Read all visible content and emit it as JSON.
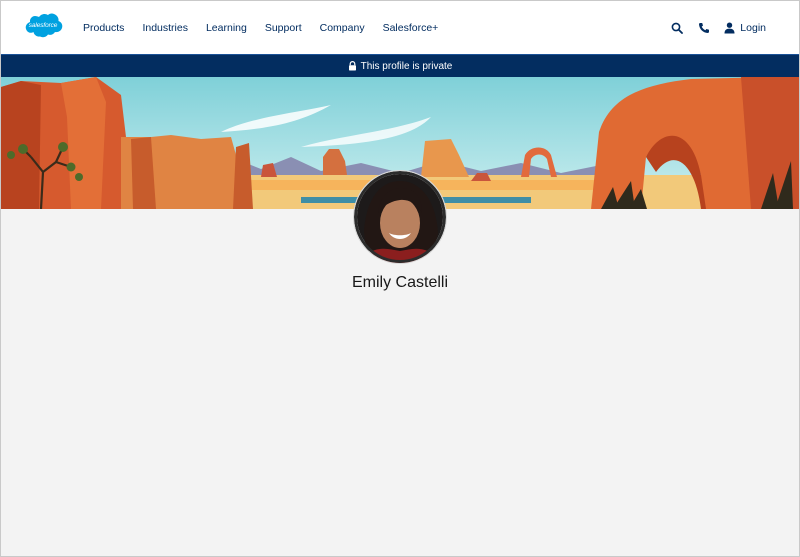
{
  "header": {
    "logo_text": "salesforce",
    "nav": [
      "Products",
      "Industries",
      "Learning",
      "Support",
      "Company",
      "Salesforce+"
    ],
    "login_label": "Login",
    "icons": [
      "search-icon",
      "phone-icon",
      "user-icon"
    ]
  },
  "banner": {
    "text": "This profile is private",
    "icon": "lock-icon"
  },
  "profile": {
    "name": "Emily Castelli"
  },
  "colors": {
    "brand_blue": "#00a1e0",
    "nav_text": "#032d60",
    "banner_bg": "#032d60",
    "page_bg": "#f3f3f3"
  }
}
